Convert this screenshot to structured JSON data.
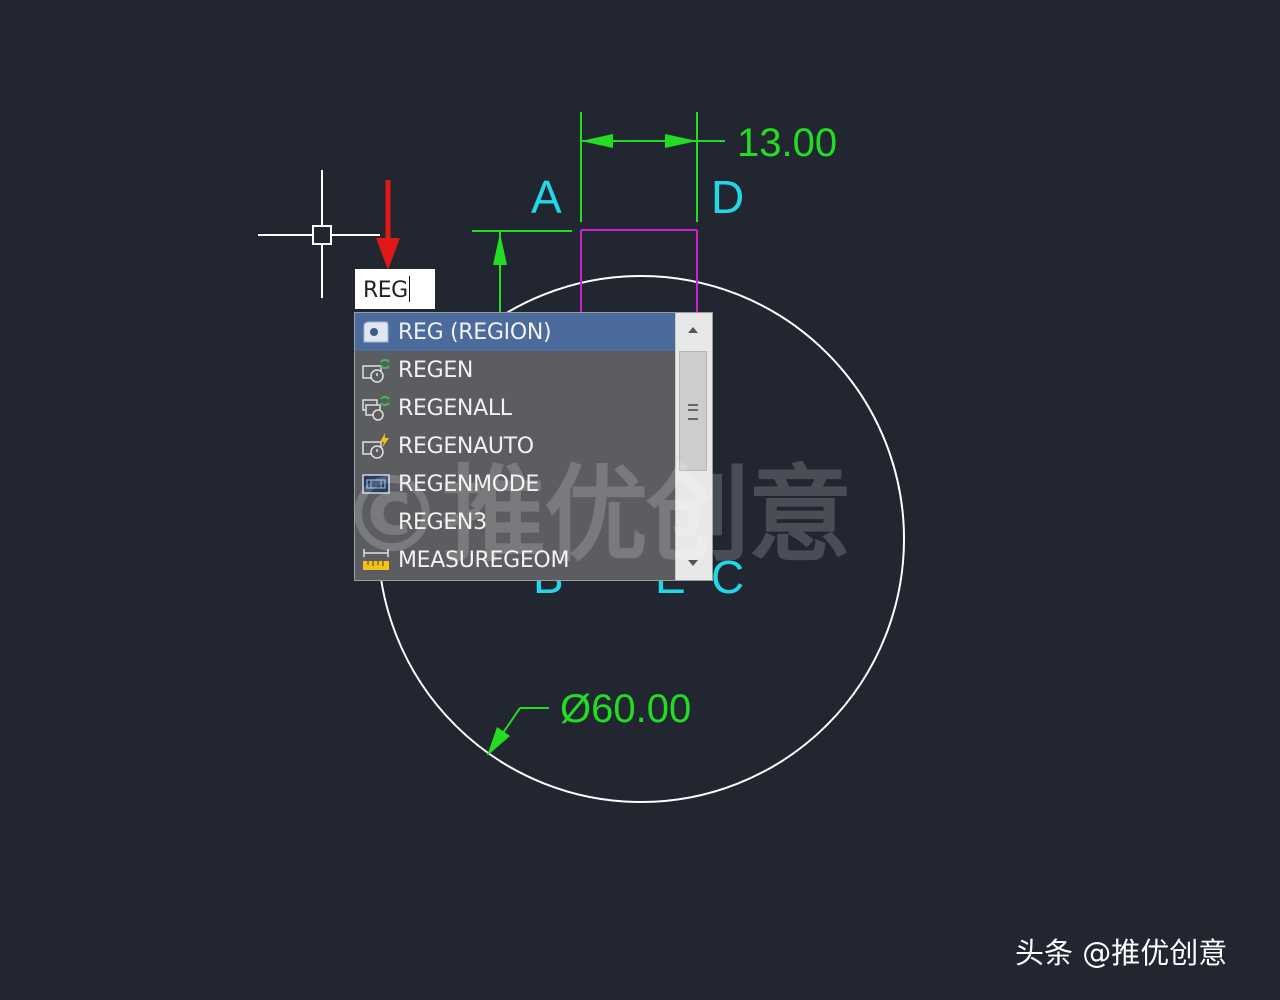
{
  "dimension": {
    "width_value": "13.00",
    "diameter_value": "Ø60.00"
  },
  "point_labels": {
    "a": "A",
    "d": "D",
    "b": "B",
    "e": "E",
    "c": "C"
  },
  "command_input": {
    "value": "REG"
  },
  "autocomplete": {
    "items": [
      {
        "label": "REG (REGION)",
        "icon": "region-icon",
        "selected": true
      },
      {
        "label": "REGEN",
        "icon": "regen-icon",
        "selected": false
      },
      {
        "label": "REGENALL",
        "icon": "regenall-icon",
        "selected": false
      },
      {
        "label": "REGENAUTO",
        "icon": "regenauto-icon",
        "selected": false
      },
      {
        "label": "REGENMODE",
        "icon": "regenmode-icon",
        "selected": false
      },
      {
        "label": "REGEN3",
        "icon": "",
        "selected": false
      },
      {
        "label": "MEASUREGEOM",
        "icon": "measuregeom-icon",
        "selected": false
      }
    ]
  },
  "watermark": "©推优创意",
  "credit": "头条 @推优创意",
  "colors": {
    "background": "#212631",
    "dimension": "#22dd22",
    "label": "#22d8e8",
    "geometry": "#ffffff",
    "slot": "#d020d0",
    "pointer_arrow": "#e01818"
  }
}
